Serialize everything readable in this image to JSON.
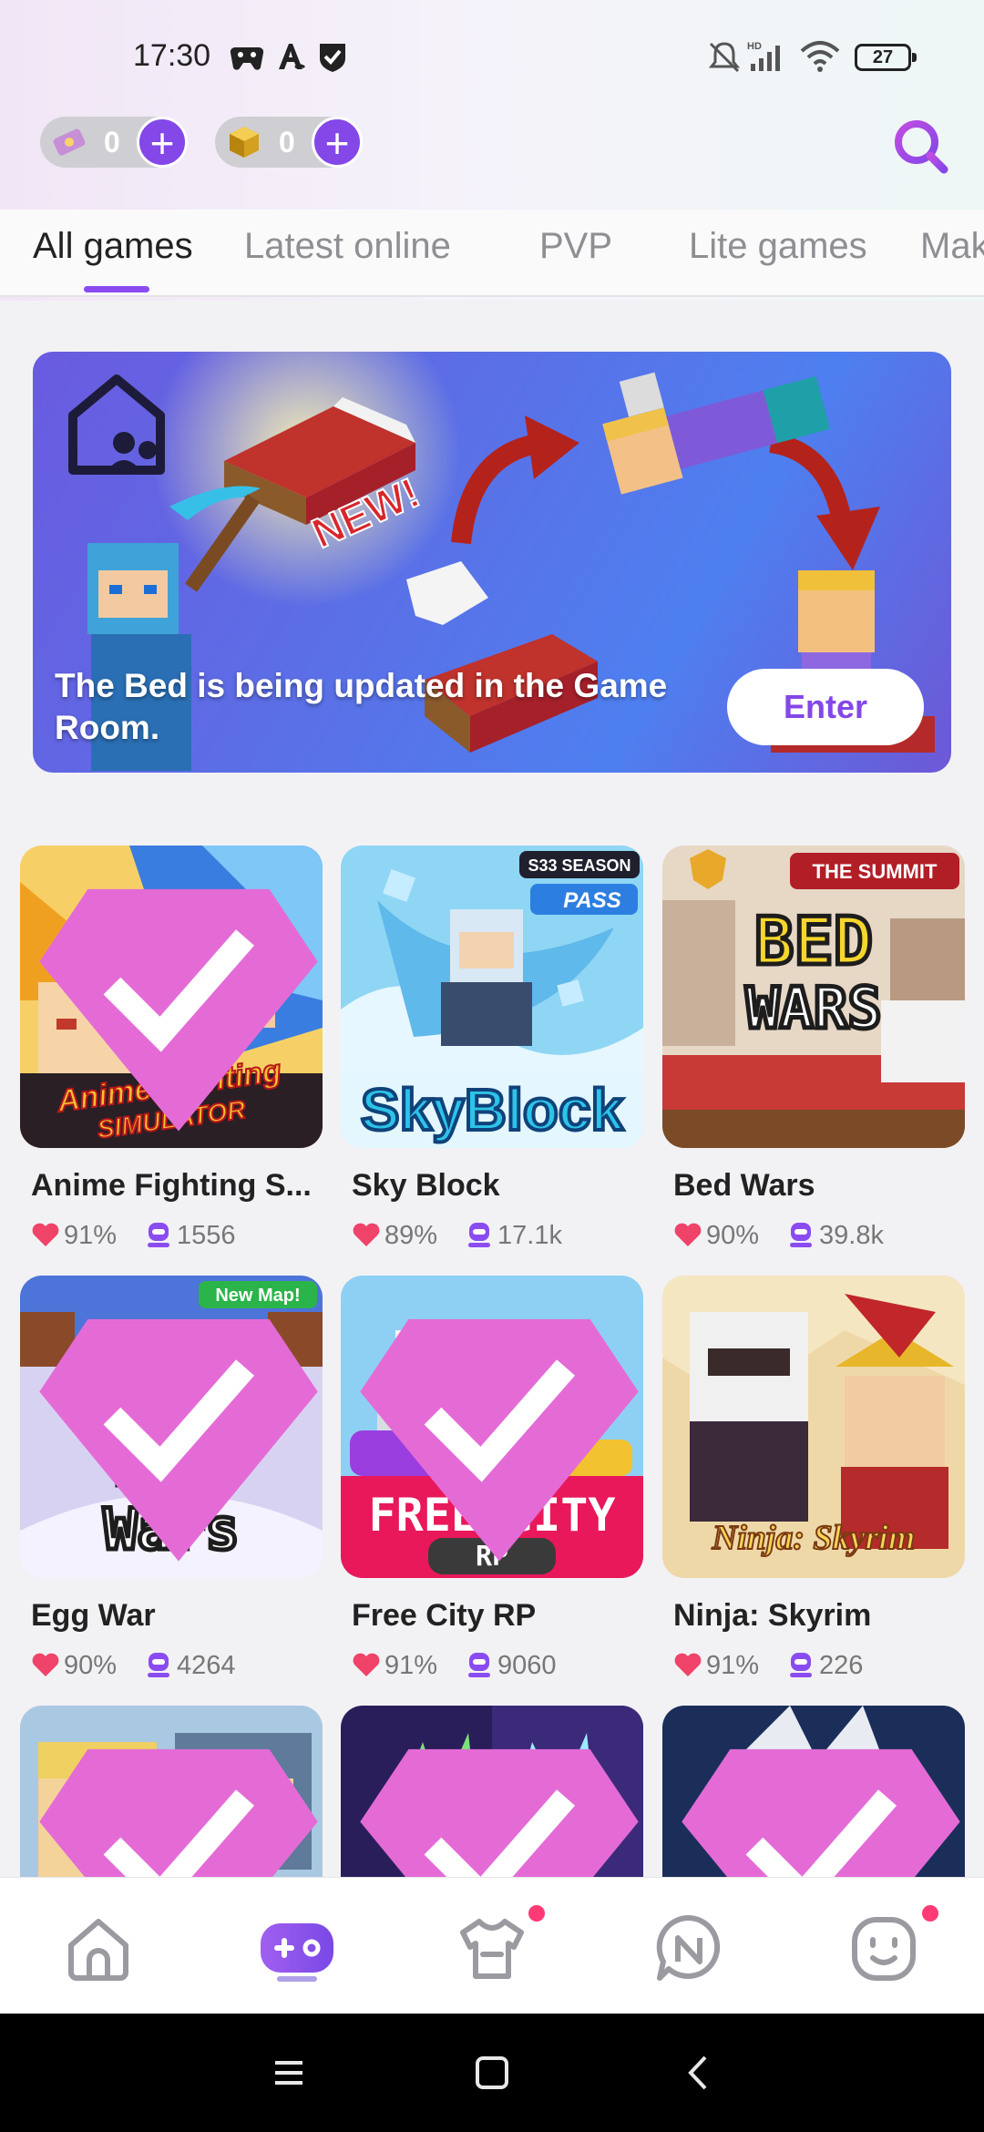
{
  "status_bar": {
    "time": "17:30",
    "battery": "27",
    "network": "HD"
  },
  "wallet": {
    "tickets": "0",
    "cubes": "0",
    "add_label": "+"
  },
  "tabs": [
    {
      "label": "All games",
      "active": true
    },
    {
      "label": "Latest online",
      "active": false
    },
    {
      "label": "PVP",
      "active": false
    },
    {
      "label": "Lite games",
      "active": false
    },
    {
      "label": "Mak",
      "active": false
    }
  ],
  "banner": {
    "text": "The Bed is being updated in the Game Room.",
    "badge": "NEW!",
    "enter_label": "Enter"
  },
  "games": [
    {
      "name": "Anime Fighting S...",
      "rating": "91%",
      "players": "1556",
      "tag": "",
      "art_title": "Anime Fighting Simulator"
    },
    {
      "name": "Sky Block",
      "rating": "89%",
      "players": "17.1k",
      "tag": "S33 SEASON",
      "tag2": "PASS",
      "art_title": "SkyBlock"
    },
    {
      "name": "Bed Wars",
      "rating": "90%",
      "players": "39.8k",
      "tag": "THE SUMMIT",
      "art_title": "BED WARS"
    },
    {
      "name": "Egg War",
      "rating": "90%",
      "players": "4264",
      "tag": "New Map!",
      "art_title": "EGG Wars"
    },
    {
      "name": "Free City RP",
      "rating": "91%",
      "players": "9060",
      "tag": "",
      "art_title": "FREE CITY",
      "art_sub": "RP"
    },
    {
      "name": "Ninja: Skyrim",
      "rating": "91%",
      "players": "226",
      "tag": "",
      "art_title": "Ninja: Skyrim"
    }
  ],
  "bottom_nav": [
    {
      "name": "home",
      "active": false
    },
    {
      "name": "games",
      "active": true
    },
    {
      "name": "wardrobe",
      "active": false
    },
    {
      "name": "news",
      "active": false
    },
    {
      "name": "profile",
      "active": false
    }
  ],
  "colors": {
    "accent": "#8447e8",
    "like": "#f0436a",
    "badge": "#ff3a74"
  }
}
